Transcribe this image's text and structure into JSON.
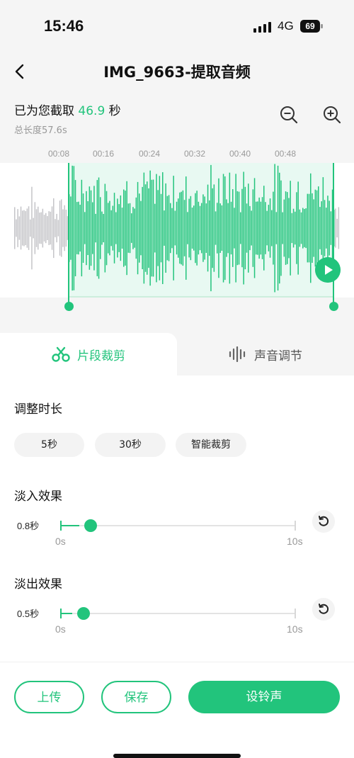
{
  "status_bar": {
    "time": "15:46",
    "network": "4G",
    "battery": "69"
  },
  "nav": {
    "title": "IMG_9663-提取音频"
  },
  "clip_info": {
    "prefix": "已为您截取",
    "seconds": "46.9",
    "suffix": "秒",
    "total": "总长度57.6s"
  },
  "ruler": {
    "labels": [
      "00:08",
      "00:16",
      "00:24",
      "00:32",
      "00:40",
      "00:48"
    ]
  },
  "tabs": {
    "trim": "片段裁剪",
    "sound": "声音调节"
  },
  "adjust": {
    "title": "调整时长",
    "options": [
      "5秒",
      "30秒",
      "智能裁剪"
    ]
  },
  "fade_in": {
    "title": "淡入效果",
    "value_label": "0.8秒",
    "value": 0.8,
    "min_label": "0s",
    "max_label": "10s",
    "max": 10
  },
  "fade_out": {
    "title": "淡出效果",
    "value_label": "0.5秒",
    "value": 0.5,
    "min_label": "0s",
    "max_label": "10s",
    "max": 10
  },
  "actions": {
    "upload": "上传",
    "save": "保存",
    "set_ringtone": "设铃声"
  },
  "colors": {
    "accent": "#22c47c",
    "wave_inactive": "#c4c4c8"
  },
  "selection": {
    "start_fraction": 0.167,
    "end_fraction": 0.98
  }
}
